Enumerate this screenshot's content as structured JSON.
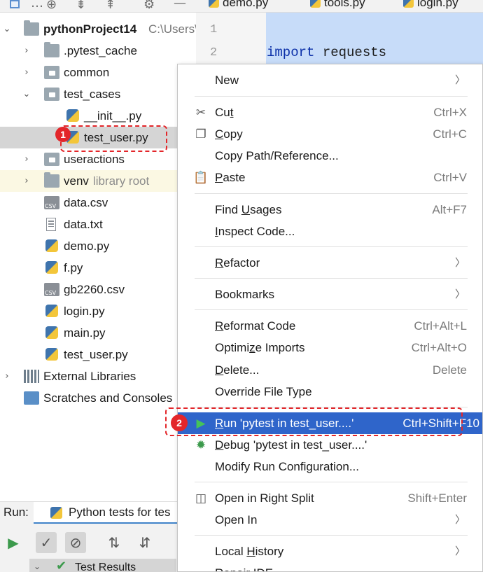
{
  "project_tree": {
    "root": {
      "name": "pythonProject14",
      "path": "C:\\Users\\"
    },
    "items": [
      {
        "label": ".pytest_cache",
        "kind": "folder"
      },
      {
        "label": "common",
        "kind": "folder"
      },
      {
        "label": "test_cases",
        "kind": "folder"
      },
      {
        "label": "__init__.py",
        "kind": "python"
      },
      {
        "label": "test_user.py",
        "kind": "python"
      },
      {
        "label": "useractions",
        "kind": "folder"
      },
      {
        "label": "venv",
        "kind": "folder",
        "hint": "library root"
      },
      {
        "label": "data.csv",
        "kind": "csv"
      },
      {
        "label": "data.txt",
        "kind": "text"
      },
      {
        "label": "demo.py",
        "kind": "python"
      },
      {
        "label": "f.py",
        "kind": "python"
      },
      {
        "label": "gb2260.csv",
        "kind": "csv"
      },
      {
        "label": "login.py",
        "kind": "python"
      },
      {
        "label": "main.py",
        "kind": "python"
      },
      {
        "label": "test_user.py",
        "kind": "python"
      }
    ],
    "external_libraries": "External Libraries",
    "scratches": "Scratches and Consoles"
  },
  "editor": {
    "tabs": [
      "demo.py",
      "tools.py",
      "login.py"
    ],
    "line_numbers": [
      "1",
      "2"
    ],
    "code_keyword": "import",
    "code_rest": " requests"
  },
  "run_panel": {
    "label": "Run:",
    "tab": "Python tests for tes",
    "test_results": "Test Results"
  },
  "annotations": {
    "badge1": "1",
    "badge2": "2"
  },
  "context_menu": {
    "new": "New",
    "cut": {
      "u": "t",
      "pre": "Cu",
      "post": "",
      "shortcut": "Ctrl+X"
    },
    "copy": {
      "u": "C",
      "pre": "",
      "post": "opy",
      "shortcut": "Ctrl+C"
    },
    "copy_path": "Copy Path/Reference...",
    "paste": {
      "u": "P",
      "pre": "",
      "post": "aste",
      "shortcut": "Ctrl+V"
    },
    "find_usages": {
      "pre": "Find ",
      "u": "U",
      "post": "sages",
      "shortcut": "Alt+F7"
    },
    "inspect_code": {
      "u": "I",
      "post": "nspect Code..."
    },
    "refactor": {
      "u": "R",
      "post": "efactor"
    },
    "bookmarks": "Bookmarks",
    "reformat": {
      "u": "R",
      "post": "eformat Code",
      "shortcut": "Ctrl+Alt+L"
    },
    "optimize": {
      "pre": "Optimi",
      "u": "z",
      "post": "e Imports",
      "shortcut": "Ctrl+Alt+O"
    },
    "delete": {
      "u": "D",
      "post": "elete...",
      "shortcut": "Delete"
    },
    "override": "Override File Type",
    "run": {
      "u": "R",
      "post": "un 'pytest in test_user....'",
      "shortcut": "Ctrl+Shift+F10"
    },
    "debug": {
      "u": "D",
      "post": "ebug 'pytest in test_user....'"
    },
    "modify_run": "Modify Run Configuration...",
    "open_right": "Open in Right Split",
    "open_right_shortcut": "Shift+Enter",
    "open_in": "Open In",
    "local_history": {
      "pre": "Local ",
      "u": "H",
      "post": "istory"
    },
    "repair_ide": "Repair IDE"
  },
  "colors": {
    "accent": "#2f65ca",
    "annotation": "#e3262a",
    "selection": "#c7dcf9"
  }
}
